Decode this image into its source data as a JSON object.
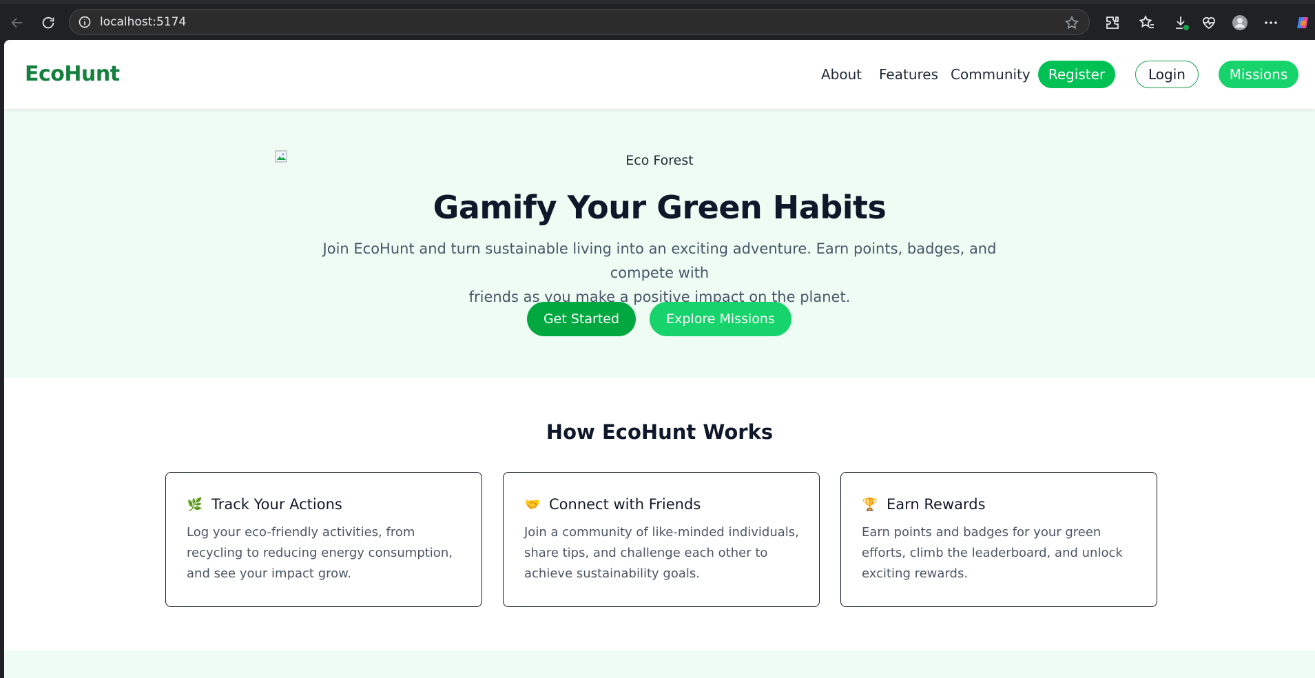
{
  "browser": {
    "url": "localhost:5174"
  },
  "header": {
    "logo": "EcoHunt",
    "nav": [
      "About",
      "Features",
      "Community"
    ],
    "register_label": "Register",
    "login_label": "Login",
    "missions_label": "Missions"
  },
  "hero": {
    "image_alt": "Eco Forest",
    "title": "Gamify Your Green Habits",
    "subtitle_line1": "Join EcoHunt and turn sustainable living into an exciting adventure. Earn points, badges, and compete with",
    "subtitle_line2": "friends as you make a positive impact on the planet.",
    "primary_button": "Get Started",
    "secondary_button": "Explore Missions"
  },
  "how": {
    "title": "How EcoHunt Works",
    "cards": [
      {
        "emoji": "🌿",
        "title": "Track Your Actions",
        "text": "Log your eco-friendly activities, from recycling to reducing energy consumption, and see your impact grow."
      },
      {
        "emoji": "🤝",
        "title": "Connect with Friends",
        "text": "Join a community of like-minded individuals, share tips, and challenge each other to achieve sustainability goals."
      },
      {
        "emoji": "🏆",
        "title": "Earn Rewards",
        "text": "Earn points and badges for your green efforts, climb the leaderboard, and unlock exciting rewards."
      }
    ]
  },
  "colors": {
    "brand_green": "#15803d",
    "accent_green": "#00c153",
    "light_green": "#17d36b",
    "hero_bg": "#effcf3"
  }
}
